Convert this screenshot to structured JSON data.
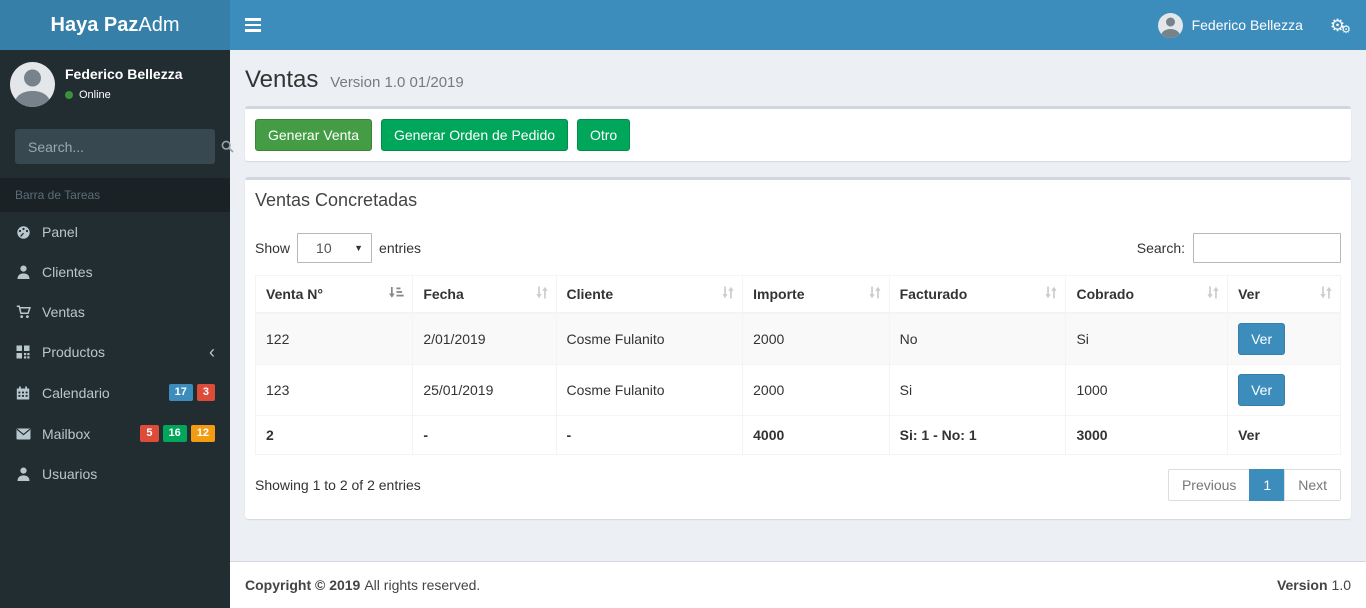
{
  "navbar": {
    "logo_bold": "Haya Paz",
    "logo_light": "Adm",
    "user_name": "Federico Bellezza"
  },
  "sidebar": {
    "user_name": "Federico Bellezza",
    "user_status": "Online",
    "search_placeholder": "Search...",
    "section_header": "Barra de Tareas",
    "items": [
      {
        "label": "Panel"
      },
      {
        "label": "Clientes"
      },
      {
        "label": "Ventas"
      },
      {
        "label": "Productos"
      },
      {
        "label": "Calendario",
        "badges": [
          {
            "text": "17",
            "color": "#3c8dbc"
          },
          {
            "text": "3",
            "color": "#dd4b39"
          }
        ]
      },
      {
        "label": "Mailbox",
        "badges": [
          {
            "text": "5",
            "color": "#dd4b39"
          },
          {
            "text": "16",
            "color": "#00a65a"
          },
          {
            "text": "12",
            "color": "#f39c12"
          }
        ]
      },
      {
        "label": "Usuarios"
      }
    ]
  },
  "page": {
    "title": "Ventas",
    "subtitle": "Version 1.0 01/2019"
  },
  "actions": {
    "buttons": [
      {
        "label": "Generar Venta",
        "color": "#449d44",
        "border": "#398439"
      },
      {
        "label": "Generar Orden de Pedido",
        "color": "#00a65a",
        "border": "#008d4c"
      },
      {
        "label": "Otro",
        "color": "#00a65a",
        "border": "#008d4c"
      }
    ]
  },
  "datatable": {
    "box_title": "Ventas Concretadas",
    "show_label": "Show",
    "entries_label": "entries",
    "page_length": "10",
    "search_label": "Search:",
    "columns": [
      "Venta N°",
      "Fecha",
      "Cliente",
      "Importe",
      "Facturado",
      "Cobrado",
      "Ver"
    ],
    "rows": [
      {
        "venta": "122",
        "fecha": "2/01/2019",
        "cliente": "Cosme Fulanito",
        "importe": "2000",
        "facturado": "No",
        "cobrado": "Si",
        "action": "Ver"
      },
      {
        "venta": "123",
        "fecha": "25/01/2019",
        "cliente": "Cosme Fulanito",
        "importe": "2000",
        "facturado": "Si",
        "cobrado": "1000",
        "action": "Ver"
      }
    ],
    "totals": {
      "venta": "2",
      "fecha": "-",
      "cliente": "-",
      "importe": "4000",
      "facturado": "Si: 1 - No: 1",
      "cobrado": "3000",
      "ver": "Ver"
    },
    "info": "Showing 1 to 2 of 2 entries",
    "pagination": {
      "previous": "Previous",
      "page": "1",
      "next": "Next"
    }
  },
  "footer": {
    "copyright_bold": "Copyright © 2019",
    "copyright_rest": "All rights reserved.",
    "version_label": "Version",
    "version_value": "1.0"
  },
  "colors": {
    "navbar": "#3c8dbc",
    "logo_bg": "#367fa9",
    "sidebar_bg": "#222d32",
    "accent_blue": "#3c8dbc",
    "success_green": "#00a65a",
    "box_top_border": "#d2d6de"
  }
}
